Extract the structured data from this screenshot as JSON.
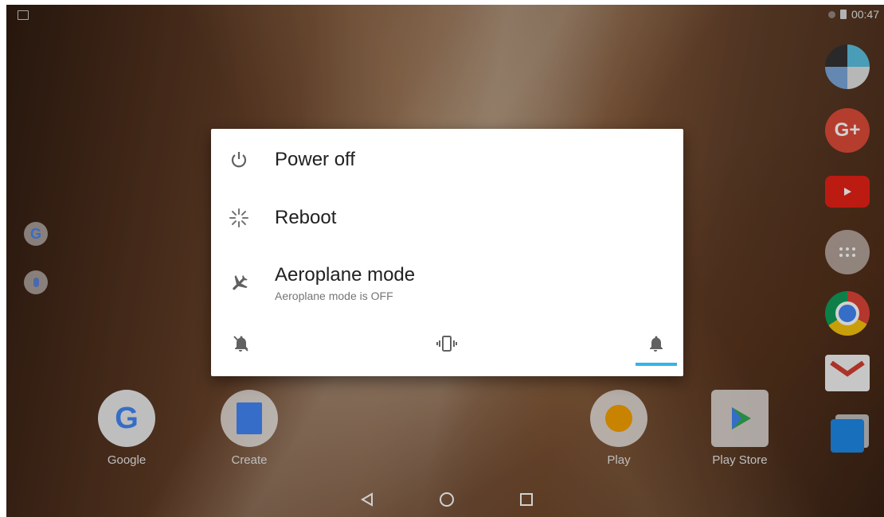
{
  "status_bar": {
    "time": "00:47"
  },
  "dialog": {
    "options": [
      {
        "label": "Power off",
        "icon": "power-icon"
      },
      {
        "label": "Reboot",
        "icon": "reboot-icon"
      },
      {
        "label": "Aeroplane mode",
        "subtitle": "Aeroplane mode is OFF",
        "icon": "airplane-icon"
      }
    ],
    "sound_modes": {
      "options": [
        "silent",
        "vibrate",
        "sound"
      ],
      "selected": "sound",
      "accent": "#33b5e5"
    }
  },
  "home": {
    "apps": [
      {
        "label": "Google"
      },
      {
        "label": "Create"
      },
      {
        "label": "Play"
      },
      {
        "label": "Play Store"
      }
    ]
  },
  "navigation": {
    "buttons": [
      "back",
      "home",
      "recents"
    ]
  }
}
